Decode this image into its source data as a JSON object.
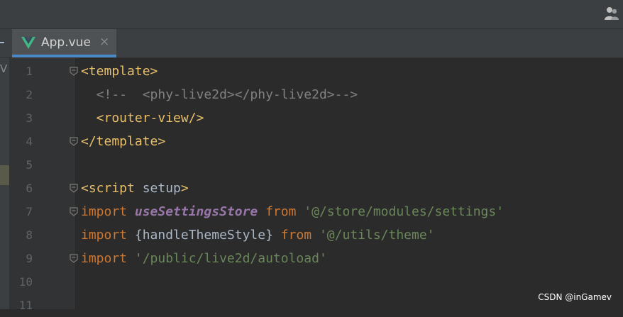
{
  "tab": {
    "label": "App.vue",
    "close": "×"
  },
  "sidebar": {
    "stub_letter": "V"
  },
  "lines": [
    {
      "num": "1",
      "tokens": [
        {
          "t": "<template>",
          "c": "tag"
        }
      ]
    },
    {
      "num": "2",
      "tokens": [
        {
          "t": "  <!--  <phy-live2d></phy-live2d>-->",
          "c": "cmt"
        }
      ]
    },
    {
      "num": "3",
      "tokens": [
        {
          "t": "  <router-view/>",
          "c": "tag"
        }
      ]
    },
    {
      "num": "4",
      "tokens": [
        {
          "t": "</template>",
          "c": "tag"
        }
      ]
    },
    {
      "num": "5",
      "tokens": []
    },
    {
      "num": "6",
      "tokens": [
        {
          "t": "<script",
          "c": "tag"
        },
        {
          "t": " setup",
          "c": "plain"
        },
        {
          "t": ">",
          "c": "tag"
        }
      ]
    },
    {
      "num": "7",
      "tokens": [
        {
          "t": "import ",
          "c": "kw"
        },
        {
          "t": "useSettingsStore",
          "c": "fn"
        },
        {
          "t": " from ",
          "c": "kw"
        },
        {
          "t": "'@/store/modules/settings'",
          "c": "str"
        }
      ]
    },
    {
      "num": "8",
      "tokens": [
        {
          "t": "import ",
          "c": "kw"
        },
        {
          "t": "{handleThemeStyle}",
          "c": "plain"
        },
        {
          "t": " from ",
          "c": "kw"
        },
        {
          "t": "'@/utils/theme'",
          "c": "str"
        }
      ]
    },
    {
      "num": "9",
      "tokens": [
        {
          "t": "import ",
          "c": "kw"
        },
        {
          "t": "'/public/live2d/autoload'",
          "c": "str"
        }
      ]
    },
    {
      "num": "10",
      "tokens": []
    },
    {
      "num": "11",
      "tokens": []
    }
  ],
  "fold_lines": [
    "1",
    "4",
    "6",
    "7",
    "9"
  ],
  "watermark": "CSDN @inGamev",
  "colors": {
    "tag": "#e8bf6a",
    "comment": "#808080",
    "keyword": "#cc7832",
    "function": "#9876aa",
    "string": "#6a8759",
    "plain": "#a9b7c6",
    "tab_underline": "#4a88c7",
    "vue_green": "#41b883"
  }
}
